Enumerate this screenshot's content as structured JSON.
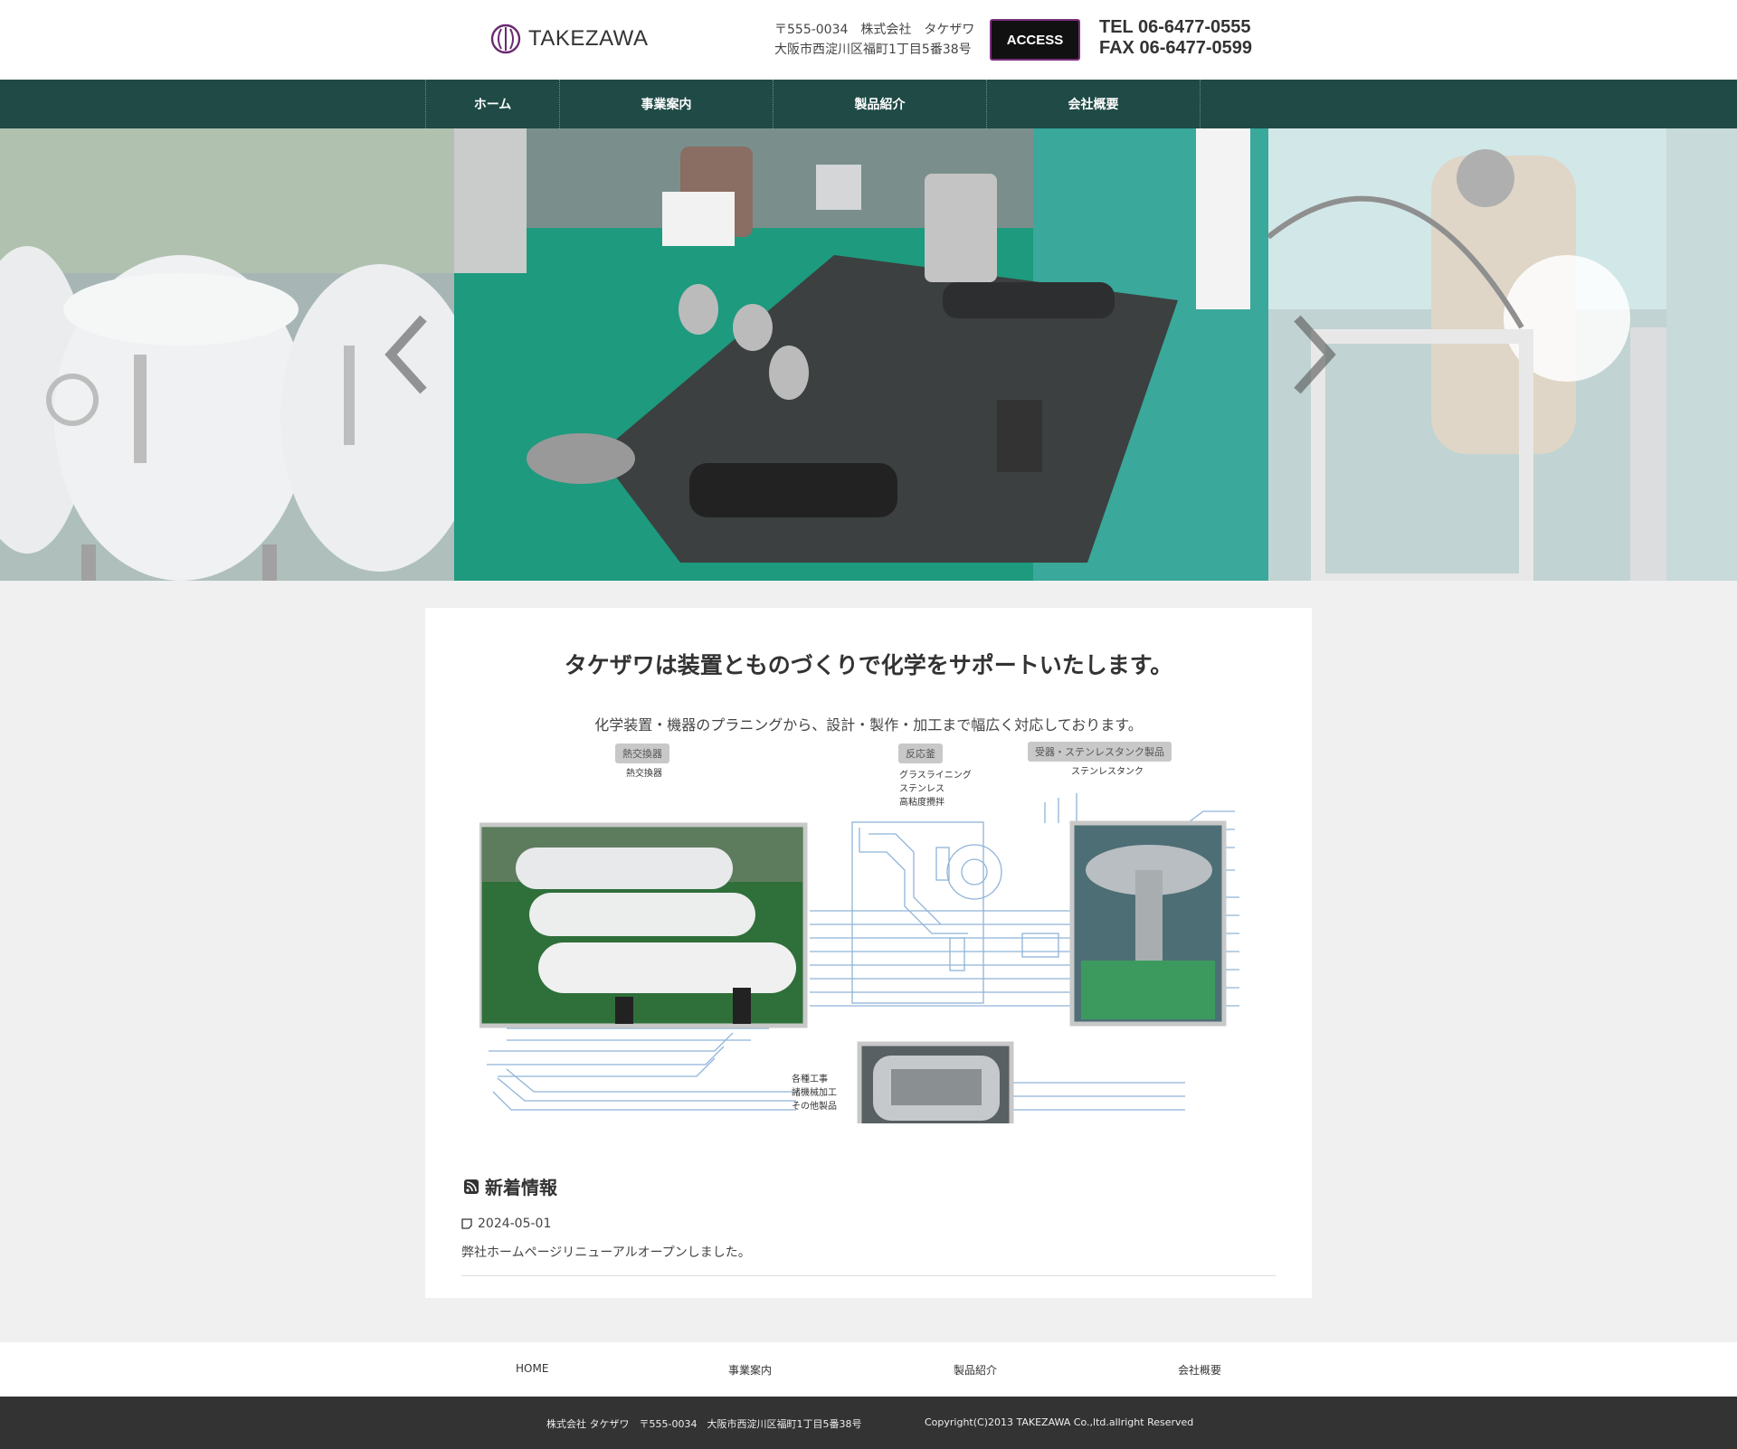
{
  "header": {
    "logo_text": "TAKEZAWA",
    "address_line1": "〒555-0034　株式会社　タケザワ",
    "address_line2": "大阪市西淀川区福町1丁目5番38号",
    "access_label": "ACCESS",
    "tel": "TEL 06-6477-0555",
    "fax": "FAX 06-6477-0599"
  },
  "nav": {
    "items": [
      {
        "label": "ホーム"
      },
      {
        "label": "事業案内"
      },
      {
        "label": "製品紹介"
      },
      {
        "label": "会社概要"
      }
    ]
  },
  "main": {
    "headline": "タケザワは装置とものづくりで化学をサポートいたします。",
    "subline": "化学装置・機器のプラニングから、設計・製作・加工まで幅広く対応しております。",
    "diagram": {
      "tag1": "熱交換器",
      "tag1_sub": "熱交換器",
      "tag2": "反応釜",
      "tag2_sub1": "グラスライニング",
      "tag2_sub2": "ステンレス",
      "tag2_sub3": "高粘度攪拌",
      "tag3": "受器・ステンレスタンク製品",
      "tag3_sub": "ステンレスタンク",
      "bottom_sub1": "各種工事",
      "bottom_sub2": "諸機械加工",
      "bottom_sub3": "その他製品"
    },
    "news": {
      "title": "新着情報",
      "date": "2024-05-01",
      "text": "弊社ホームページリニューアルオープンしました。"
    }
  },
  "footer": {
    "nav": [
      "HOME",
      "事業案内",
      "製品紹介",
      "会社概要"
    ],
    "company": "株式会社 タケザワ　〒555-0034　大阪市西淀川区福町1丁目5番38号",
    "copyright": "Copyright(C)2013 TAKEZAWA Co.,ltd.allright Reserved"
  },
  "colors": {
    "nav_bg": "#1f4a46",
    "access_border": "#7a2f7e",
    "footer_bg": "#333333"
  }
}
